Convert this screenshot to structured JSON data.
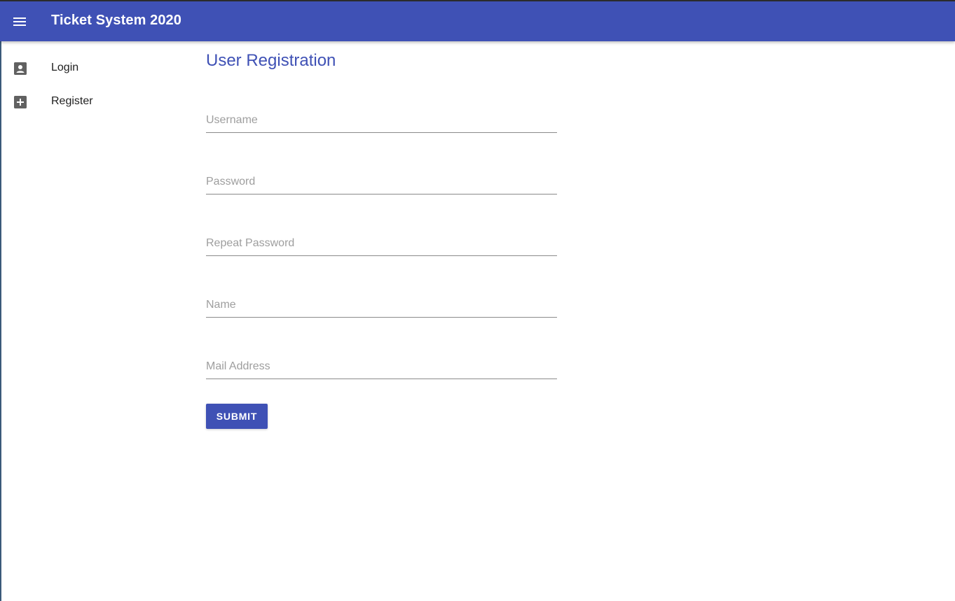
{
  "header": {
    "title": "Ticket System 2020",
    "menu_icon": "menu-icon"
  },
  "sidebar": {
    "items": [
      {
        "label": "Login",
        "icon": "account-box-icon"
      },
      {
        "label": "Register",
        "icon": "add-box-icon"
      }
    ]
  },
  "main": {
    "title": "User Registration",
    "fields": [
      {
        "placeholder": "Username",
        "value": ""
      },
      {
        "placeholder": "Password",
        "value": ""
      },
      {
        "placeholder": "Repeat Password",
        "value": ""
      },
      {
        "placeholder": "Name",
        "value": ""
      },
      {
        "placeholder": "Mail Address",
        "value": ""
      }
    ],
    "submit_label": "SUBMIT"
  },
  "colors": {
    "primary": "#3f51b5",
    "icon": "#616161"
  }
}
